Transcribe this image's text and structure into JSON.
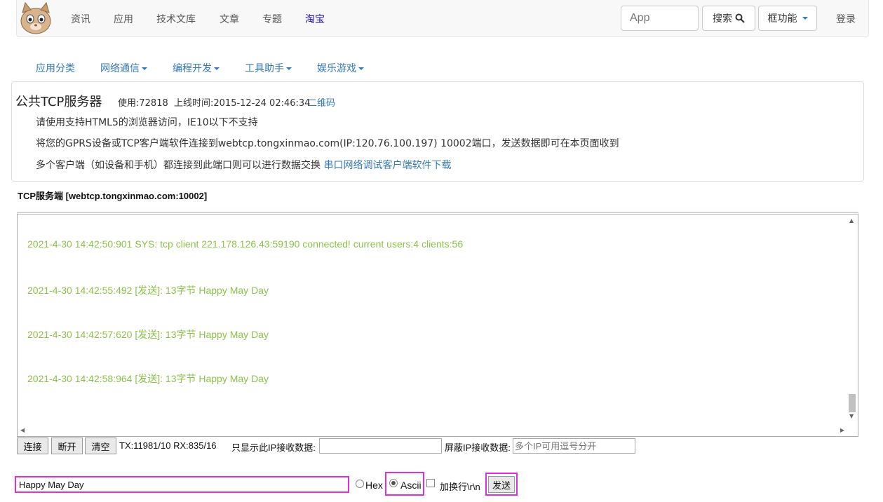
{
  "navbar": {
    "items": [
      "资讯",
      "应用",
      "技术文库",
      "文章",
      "专题",
      "淘宝"
    ],
    "search_placeholder": "App",
    "search_button": "搜索",
    "tools_button": "框功能",
    "login": "登录"
  },
  "subnav": {
    "items": [
      "应用分类",
      "网络通信",
      "编程开发",
      "工具助手",
      "娱乐游戏"
    ]
  },
  "panel": {
    "title": "公共TCP服务器",
    "usage": "使用:72818",
    "online_time": "上线时间:2015-12-24 02:46:34",
    "qrcode_link": "二维码",
    "line1": "请使用支持HTML5的浏览器访问，IE10以下不支持",
    "line2": "将您的GPRS设备或TCP客户端软件连接到webtcp.tongxinmao.com(IP:120.76.100.197) 10002端口，发送数据即可在本页面收到",
    "line3": "多个客户端（如设备和手机）都连接到此端口则可以进行数据交换",
    "download_link": "串口网络调试客户端软件下载"
  },
  "server_label": "TCP服务端 [webtcp.tongxinmao.com:10002]",
  "log": {
    "lines": [
      "2021-4-30 14:42:50:901 SYS: tcp client 221.178.126.43:59190 connected! current users:4 clients:56",
      "2021-4-30 14:42:55:492 [发送]: 13字节 Happy May Day",
      "2021-4-30 14:42:57:620 [发送]: 13字节 Happy May Day",
      "2021-4-30 14:42:58:964 [发送]: 13字节 Happy May Day"
    ],
    "color": "#8bc34a"
  },
  "toolbar": {
    "connect": "连接",
    "disconnect": "断开",
    "clear": "清空",
    "stats": "TX:11981/10 RX:835/16",
    "filter_label": "只显示此IP接收数据:",
    "block_label": "屏蔽IP接收数据:",
    "block_placeholder": "多个IP可用逗号分开"
  },
  "send": {
    "value": "Happy May Day",
    "hex_label": "Hex",
    "ascii_label": "Ascii",
    "newline_label": "加换行\\r\\n",
    "send_button": "发送",
    "selected_mode": "Ascii"
  },
  "colors": {
    "highlight": "#e02fd9",
    "link": "#337ab7"
  }
}
